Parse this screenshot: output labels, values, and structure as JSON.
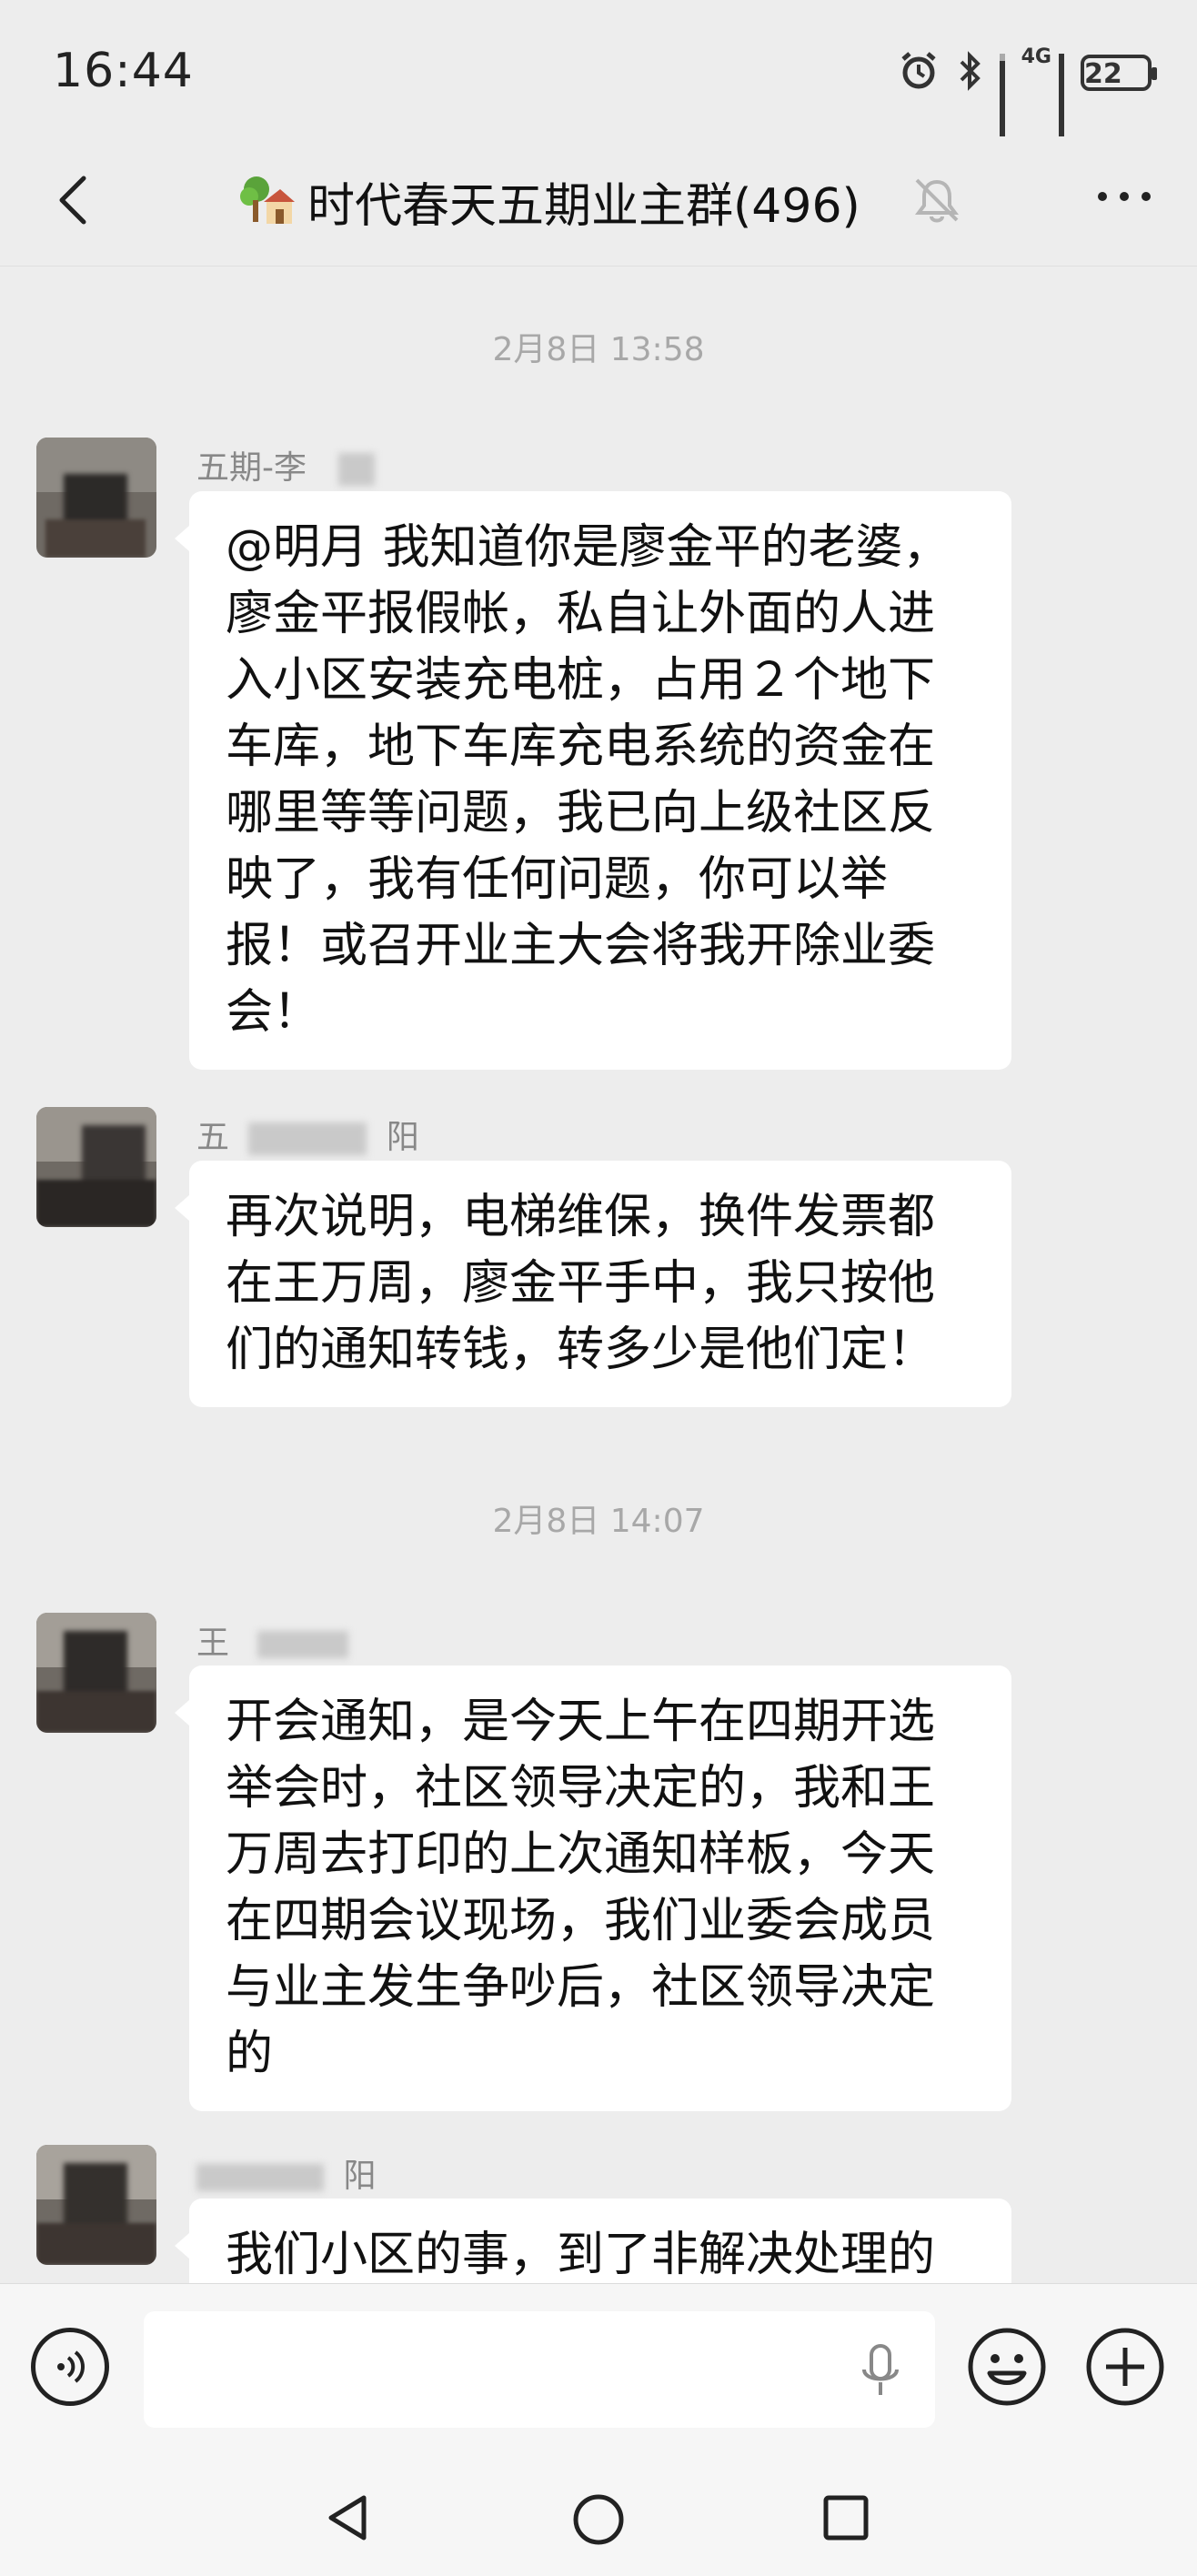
{
  "status_bar": {
    "time": "16:44",
    "network": "4G",
    "battery": "22"
  },
  "header": {
    "title": "时代春天五期业主群(496)",
    "icons": [
      "back-arrow-icon",
      "house-icon",
      "mute-bell-icon",
      "more-dots-icon"
    ]
  },
  "messages": [
    {
      "type": "time",
      "text": "2月8日 13:58"
    },
    {
      "type": "message",
      "sender": "五期-李",
      "text": "@明月  我知道你是廖金平的老婆，廖金平报假帐，私自让外面的人进入小区安装充电桩，占用２个地下车库，地下车库充电系统的资金在哪里等等问题，我已向上级社区反映了，我有任何问题，你可以举报！或召开业主大会将我开除业委会！"
    },
    {
      "type": "message",
      "sender": "五",
      "sender_tail": "阳",
      "text": "再次说明，电梯维保，换件发票都在王万周，廖金平手中，我只按他们的通知转钱，转多少是他们定！"
    },
    {
      "type": "time",
      "text": "2月8日 14:07"
    },
    {
      "type": "message",
      "sender": "王",
      "text": "开会通知，是今天上午在四期开选举会时，社区领导决定的，我和王万周去打印的上次通知样板，今天在四期会议现场，我们业委会成员与业主发生争吵后，社区领导决定的"
    },
    {
      "type": "message",
      "sender": "",
      "sender_tail": "阳",
      "text": "我们小区的事，到了非解决处理的"
    }
  ],
  "input_bar": {
    "placeholder": "",
    "icons": [
      "voice-icon",
      "microphone-icon",
      "emoji-icon",
      "plus-icon"
    ]
  },
  "nav_bar": {
    "icons": [
      "nav-back-icon",
      "nav-home-icon",
      "nav-recent-icon"
    ]
  },
  "colors": {
    "background": "#ededed",
    "bubble": "#ffffff",
    "timestamp": "#a8a8a8",
    "sender_name": "#888888"
  }
}
